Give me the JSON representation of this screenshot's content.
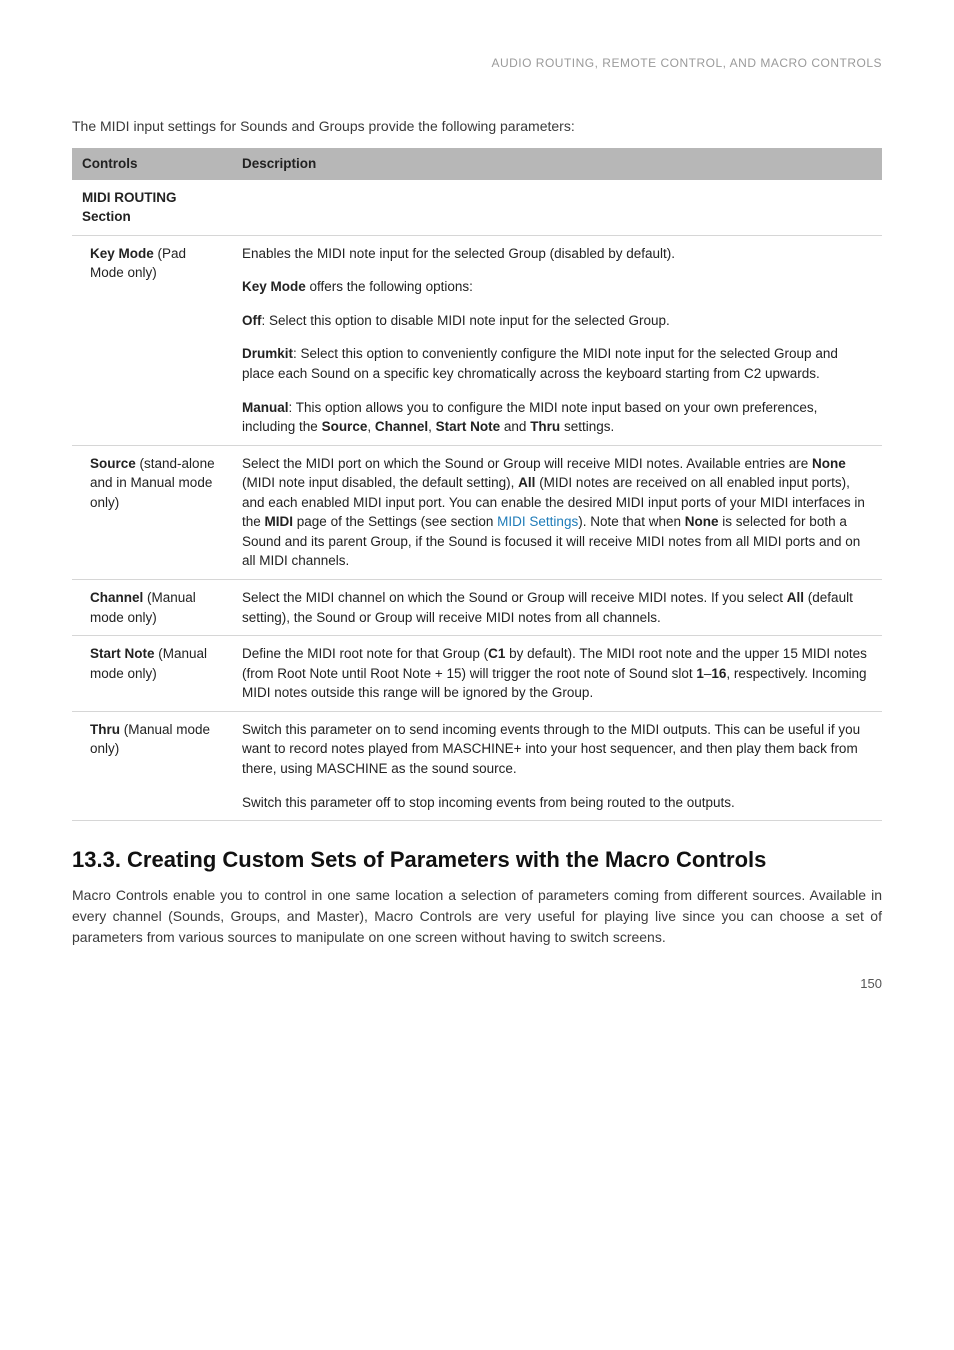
{
  "running_head": "AUDIO ROUTING, REMOTE CONTROL, AND MACRO CONTROLS",
  "intro": "The MIDI input settings for Sounds and Groups provide the following parameters:",
  "table": {
    "headers": {
      "controls": "Controls",
      "description": "Description"
    },
    "section_label": "MIDI ROUTING Section",
    "rows": {
      "keymode": {
        "name": "Key Mode",
        "sub": " (Pad Mode only)",
        "p1_a": "Enables the MIDI note input for the selected Group (disabled by default).",
        "p2_pre": "Key Mode",
        "p2_post": " offers the following options:",
        "p3_pre": "Off",
        "p3_post": ": Select this option to disable MIDI note input for the selected Group.",
        "p4_pre": "Drumkit",
        "p4_post": ": Select this option to conveniently configure the MIDI note input for the selected Group and place each Sound on a specific key chromatically across the keyboard starting from C2 upwards.",
        "p5_pre": "Manual",
        "p5_mid1": ": This option allows you to configure the MIDI note input based on your own preferences, including the ",
        "p5_b1": "Source",
        "p5_sep1": ", ",
        "p5_b2": "Channel",
        "p5_sep2": ", ",
        "p5_b3": "Start Note",
        "p5_sep3": " and ",
        "p5_b4": "Thru",
        "p5_end": " settings."
      },
      "source": {
        "name": "Source",
        "sub": " (stand-alone and in Manual mode only)",
        "t1": "Select the MIDI port on which the Sound or Group will receive MIDI notes. Available entries are ",
        "b1": "None",
        "t2": " (MIDI note input disabled, the default setting), ",
        "b2": "All",
        "t3": " (MIDI notes are received on all enabled input ports), and each enabled MIDI input port. You can enable the desired MIDI input ports of your MIDI interfaces in the ",
        "b3": "MIDI",
        "t4": " page of the Settings (see section ",
        "link": "MIDI Settings",
        "t5": "). Note that when ",
        "b4": "None",
        "t6": " is selected for both a Sound and its parent Group, if the Sound is focused it will receive MIDI notes from all MIDI ports and on all MIDI channels."
      },
      "channel": {
        "name": "Channel",
        "sub": " (Manual mode only)",
        "t1": "Select the MIDI channel on which the Sound or Group will receive MIDI notes. If you select ",
        "b1": "All",
        "t2": " (default setting), the Sound or Group will receive MIDI notes from all channels."
      },
      "startnote": {
        "name": "Start Note",
        "sub": " (Manual mode only)",
        "t1": "Define the MIDI root note for that Group (",
        "b1": "C1",
        "t2": " by default). The MIDI root note and the upper 15 MIDI notes (from Root Note until Root Note + 15) will trigger the root note of Sound slot ",
        "b2": "1",
        "dash": "–",
        "b3": "16",
        "t3": ", respectively. Incoming MIDI notes outside this range will be ignored by the Group."
      },
      "thru": {
        "name": "Thru",
        "sub": " (Manual mode only)",
        "p1": "Switch this parameter on to send incoming events through to the MIDI outputs. This can be useful if you want to record notes played from MASCHINE+ into your host sequencer, and then play them back from there, using MASCHINE as the sound source.",
        "p2": "Switch this parameter off to stop incoming events from being routed to the outputs."
      }
    }
  },
  "section": {
    "title": "13.3. Creating Custom Sets of Parameters with the Macro Controls",
    "body": "Macro Controls enable you to control in one same location a selection of parameters coming from different sources. Available in every channel (Sounds, Groups, and Master), Macro Controls are very useful for playing live since you can choose a set of parameters from various sources to manipulate on one screen without having to switch screens."
  },
  "page_number": "150"
}
